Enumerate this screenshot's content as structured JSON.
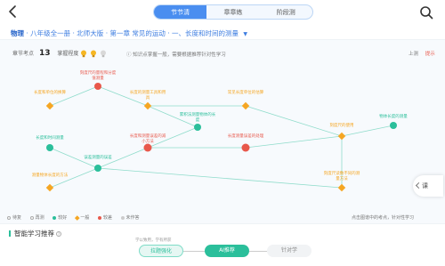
{
  "header": {
    "tabs": [
      {
        "label": "节节清",
        "active": true
      },
      {
        "label": "章章练",
        "active": false
      },
      {
        "label": "阶段测",
        "active": false
      }
    ]
  },
  "breadcrumb": {
    "subject": "物理",
    "path": "· 八年级全一册 · 北师大版 · 第一章 常见的运动 · 一、长度和时间的测量"
  },
  "info": {
    "count_label": "章节考点",
    "count_value": "13",
    "mastery_label": "掌握程度",
    "hint": "知识点掌握一般，需要根据推荐针对性学习",
    "link_up": "上测",
    "link_review": "提示"
  },
  "map": {
    "nodes": [
      {
        "kind": "dot-red",
        "label": "刻度尺的量程和分度值测量"
      },
      {
        "kind": "diamond",
        "label": "长度和单位的换算"
      },
      {
        "kind": "diamond",
        "label": "长度的测量工具和用具"
      },
      {
        "kind": "diamond",
        "label": "常见长度单位的估算"
      },
      {
        "kind": "dot-teal",
        "label": "累积法测量物体的长度"
      },
      {
        "kind": "dot-teal",
        "label": "物体长度的测量"
      },
      {
        "kind": "dot-teal",
        "label": "长度和时间测量"
      },
      {
        "kind": "dot-red",
        "label": "长度和测量误差的减小方法"
      },
      {
        "kind": "dot-red",
        "label": "长度测量误差的处理"
      },
      {
        "kind": "diamond",
        "label": "刻度尺的使用"
      },
      {
        "kind": "dot-teal",
        "label": "误差测量的误差"
      },
      {
        "kind": "diamond",
        "label": "测量物体长度的方法"
      },
      {
        "kind": "diamond",
        "label": "刻度尺读数不同的测量方法"
      }
    ],
    "expand_label": "课"
  },
  "legend": {
    "items": [
      "待复",
      "再测",
      "较好",
      "一般",
      "较差",
      "未作答"
    ],
    "note": "点击图谱中的考点，针对性学习"
  },
  "recommend": {
    "title": "智能学习推荐",
    "subtitle": "学以致用，学有所获",
    "steps": [
      "拉题强化",
      "AI推荐",
      "针对学"
    ]
  },
  "colors": {
    "accent": "#4a8ef0",
    "teal": "#2bbf9b",
    "red": "#e8584b",
    "orange": "#f5a623"
  }
}
